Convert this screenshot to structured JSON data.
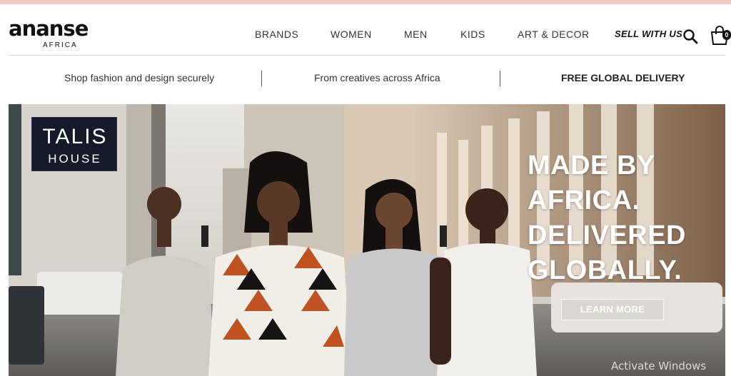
{
  "brand": {
    "name": "ananse",
    "sub": "AFRICA"
  },
  "nav": {
    "brands": "BRANDS",
    "women": "WOMEN",
    "men": "MEN",
    "kids": "KIDS",
    "art_decor": "ART & DECOR",
    "sell": "SELL WITH US"
  },
  "icons": {
    "search": "search-icon",
    "cart": "shopping-bag-icon"
  },
  "cart": {
    "count": "0"
  },
  "strip": {
    "item1": "Shop fashion and design securely",
    "item2": "From creatives across Africa",
    "item3": "FREE GLOBAL DELIVERY"
  },
  "hero": {
    "sign_line1": "TALIS",
    "sign_line2": "HOUSE",
    "headline": [
      "MADE BY",
      "AFRICA.",
      "DELIVERED",
      "GLOBALLY."
    ],
    "cta": "LEARN MORE"
  },
  "overlay": {
    "watermark": "Activate Windows"
  },
  "colors": {
    "accent_top": "#f3c9bd",
    "text": "#222222",
    "sign_bg": "#151a2a"
  }
}
